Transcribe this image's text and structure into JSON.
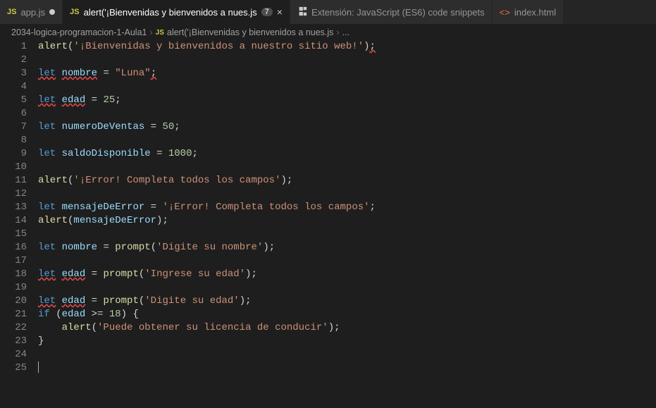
{
  "tabs": [
    {
      "icon": "JS",
      "label": "app.js",
      "dirty": true,
      "active": false
    },
    {
      "icon": "JS",
      "label": "alert('¡Bienvenidas y bienvenidos a nues.js",
      "badge": "7",
      "active": true,
      "close": true
    },
    {
      "icon": "ext",
      "label": "Extensión: JavaScript (ES6) code snippets",
      "active": false
    },
    {
      "icon": "html",
      "label": "index.html",
      "active": false
    }
  ],
  "breadcrumbs": {
    "folder": "2034-logica-programacion-1-Aula1",
    "file": "alert('¡Bienvenidas y bienvenidos a nues.js",
    "more": "..."
  },
  "code": {
    "lines": [
      {
        "n": 1,
        "tokens": [
          [
            "fn",
            "alert"
          ],
          [
            "pun",
            "("
          ],
          [
            "str",
            "'¡Bienvenidas y bienvenidos a nuestro sitio web!'"
          ],
          [
            "pun",
            ")"
          ],
          [
            "err",
            ";"
          ]
        ]
      },
      {
        "n": 2,
        "tokens": []
      },
      {
        "n": 3,
        "tokens": [
          [
            "kwerr",
            "let"
          ],
          [
            "sp",
            " "
          ],
          [
            "varerr",
            "nombre"
          ],
          [
            "sp",
            " "
          ],
          [
            "pun",
            "="
          ],
          [
            "sp",
            " "
          ],
          [
            "str",
            "\"Luna\""
          ],
          [
            "err",
            ";"
          ]
        ]
      },
      {
        "n": 4,
        "tokens": []
      },
      {
        "n": 5,
        "tokens": [
          [
            "kwerr",
            "let"
          ],
          [
            "sp",
            " "
          ],
          [
            "varerr",
            "edad"
          ],
          [
            "sp",
            " "
          ],
          [
            "pun",
            "="
          ],
          [
            "sp",
            " "
          ],
          [
            "num",
            "25"
          ],
          [
            "pun",
            ";"
          ]
        ]
      },
      {
        "n": 6,
        "tokens": []
      },
      {
        "n": 7,
        "tokens": [
          [
            "kw",
            "let"
          ],
          [
            "sp",
            " "
          ],
          [
            "var",
            "numeroDeVentas"
          ],
          [
            "sp",
            " "
          ],
          [
            "pun",
            "="
          ],
          [
            "sp",
            " "
          ],
          [
            "num",
            "50"
          ],
          [
            "pun",
            ";"
          ]
        ]
      },
      {
        "n": 8,
        "tokens": []
      },
      {
        "n": 9,
        "tokens": [
          [
            "kw",
            "let"
          ],
          [
            "sp",
            " "
          ],
          [
            "var",
            "saldoDisponible"
          ],
          [
            "sp",
            " "
          ],
          [
            "pun",
            "="
          ],
          [
            "sp",
            " "
          ],
          [
            "num",
            "1000"
          ],
          [
            "pun",
            ";"
          ]
        ]
      },
      {
        "n": 10,
        "tokens": []
      },
      {
        "n": 11,
        "tokens": [
          [
            "fn",
            "alert"
          ],
          [
            "pun",
            "("
          ],
          [
            "str",
            "'¡Error! Completa todos los campos'"
          ],
          [
            "pun",
            ");"
          ]
        ]
      },
      {
        "n": 12,
        "tokens": []
      },
      {
        "n": 13,
        "tokens": [
          [
            "kw",
            "let"
          ],
          [
            "sp",
            " "
          ],
          [
            "var",
            "mensajeDeError"
          ],
          [
            "sp",
            " "
          ],
          [
            "pun",
            "="
          ],
          [
            "sp",
            " "
          ],
          [
            "str",
            "'¡Error! Completa todos los campos'"
          ],
          [
            "pun",
            ";"
          ]
        ]
      },
      {
        "n": 14,
        "tokens": [
          [
            "fn",
            "alert"
          ],
          [
            "pun",
            "("
          ],
          [
            "var",
            "mensajeDeError"
          ],
          [
            "pun",
            ");"
          ]
        ]
      },
      {
        "n": 15,
        "tokens": []
      },
      {
        "n": 16,
        "tokens": [
          [
            "kw",
            "let"
          ],
          [
            "sp",
            " "
          ],
          [
            "var",
            "nombre"
          ],
          [
            "sp",
            " "
          ],
          [
            "pun",
            "="
          ],
          [
            "sp",
            " "
          ],
          [
            "fn",
            "prompt"
          ],
          [
            "pun",
            "("
          ],
          [
            "str",
            "'Digite su nombre'"
          ],
          [
            "pun",
            ");"
          ]
        ]
      },
      {
        "n": 17,
        "tokens": []
      },
      {
        "n": 18,
        "tokens": [
          [
            "kwerr",
            "let"
          ],
          [
            "sp",
            " "
          ],
          [
            "varerr",
            "edad"
          ],
          [
            "sp",
            " "
          ],
          [
            "pun",
            "="
          ],
          [
            "sp",
            " "
          ],
          [
            "fn",
            "prompt"
          ],
          [
            "pun",
            "("
          ],
          [
            "str",
            "'Ingrese su edad'"
          ],
          [
            "pun",
            ");"
          ]
        ]
      },
      {
        "n": 19,
        "tokens": []
      },
      {
        "n": 20,
        "tokens": [
          [
            "kwerr",
            "let"
          ],
          [
            "sp",
            " "
          ],
          [
            "varerr",
            "edad"
          ],
          [
            "sp",
            " "
          ],
          [
            "pun",
            "="
          ],
          [
            "sp",
            " "
          ],
          [
            "fn",
            "prompt"
          ],
          [
            "pun",
            "("
          ],
          [
            "str",
            "'Digite su edad'"
          ],
          [
            "pun",
            ");"
          ]
        ]
      },
      {
        "n": 21,
        "tokens": [
          [
            "kw",
            "if"
          ],
          [
            "sp",
            " "
          ],
          [
            "pun",
            "("
          ],
          [
            "var",
            "edad"
          ],
          [
            "sp",
            " "
          ],
          [
            "pun",
            ">="
          ],
          [
            "sp",
            " "
          ],
          [
            "num",
            "18"
          ],
          [
            "pun",
            ") {"
          ]
        ]
      },
      {
        "n": 22,
        "tokens": [
          [
            "sp",
            "    "
          ],
          [
            "fn",
            "alert"
          ],
          [
            "pun",
            "("
          ],
          [
            "str",
            "'Puede obtener su licencia de conducir'"
          ],
          [
            "pun",
            ");"
          ]
        ]
      },
      {
        "n": 23,
        "tokens": [
          [
            "pun",
            "}"
          ]
        ]
      },
      {
        "n": 24,
        "tokens": []
      },
      {
        "n": 25,
        "tokens": [
          [
            "cursor",
            ""
          ]
        ]
      }
    ]
  }
}
